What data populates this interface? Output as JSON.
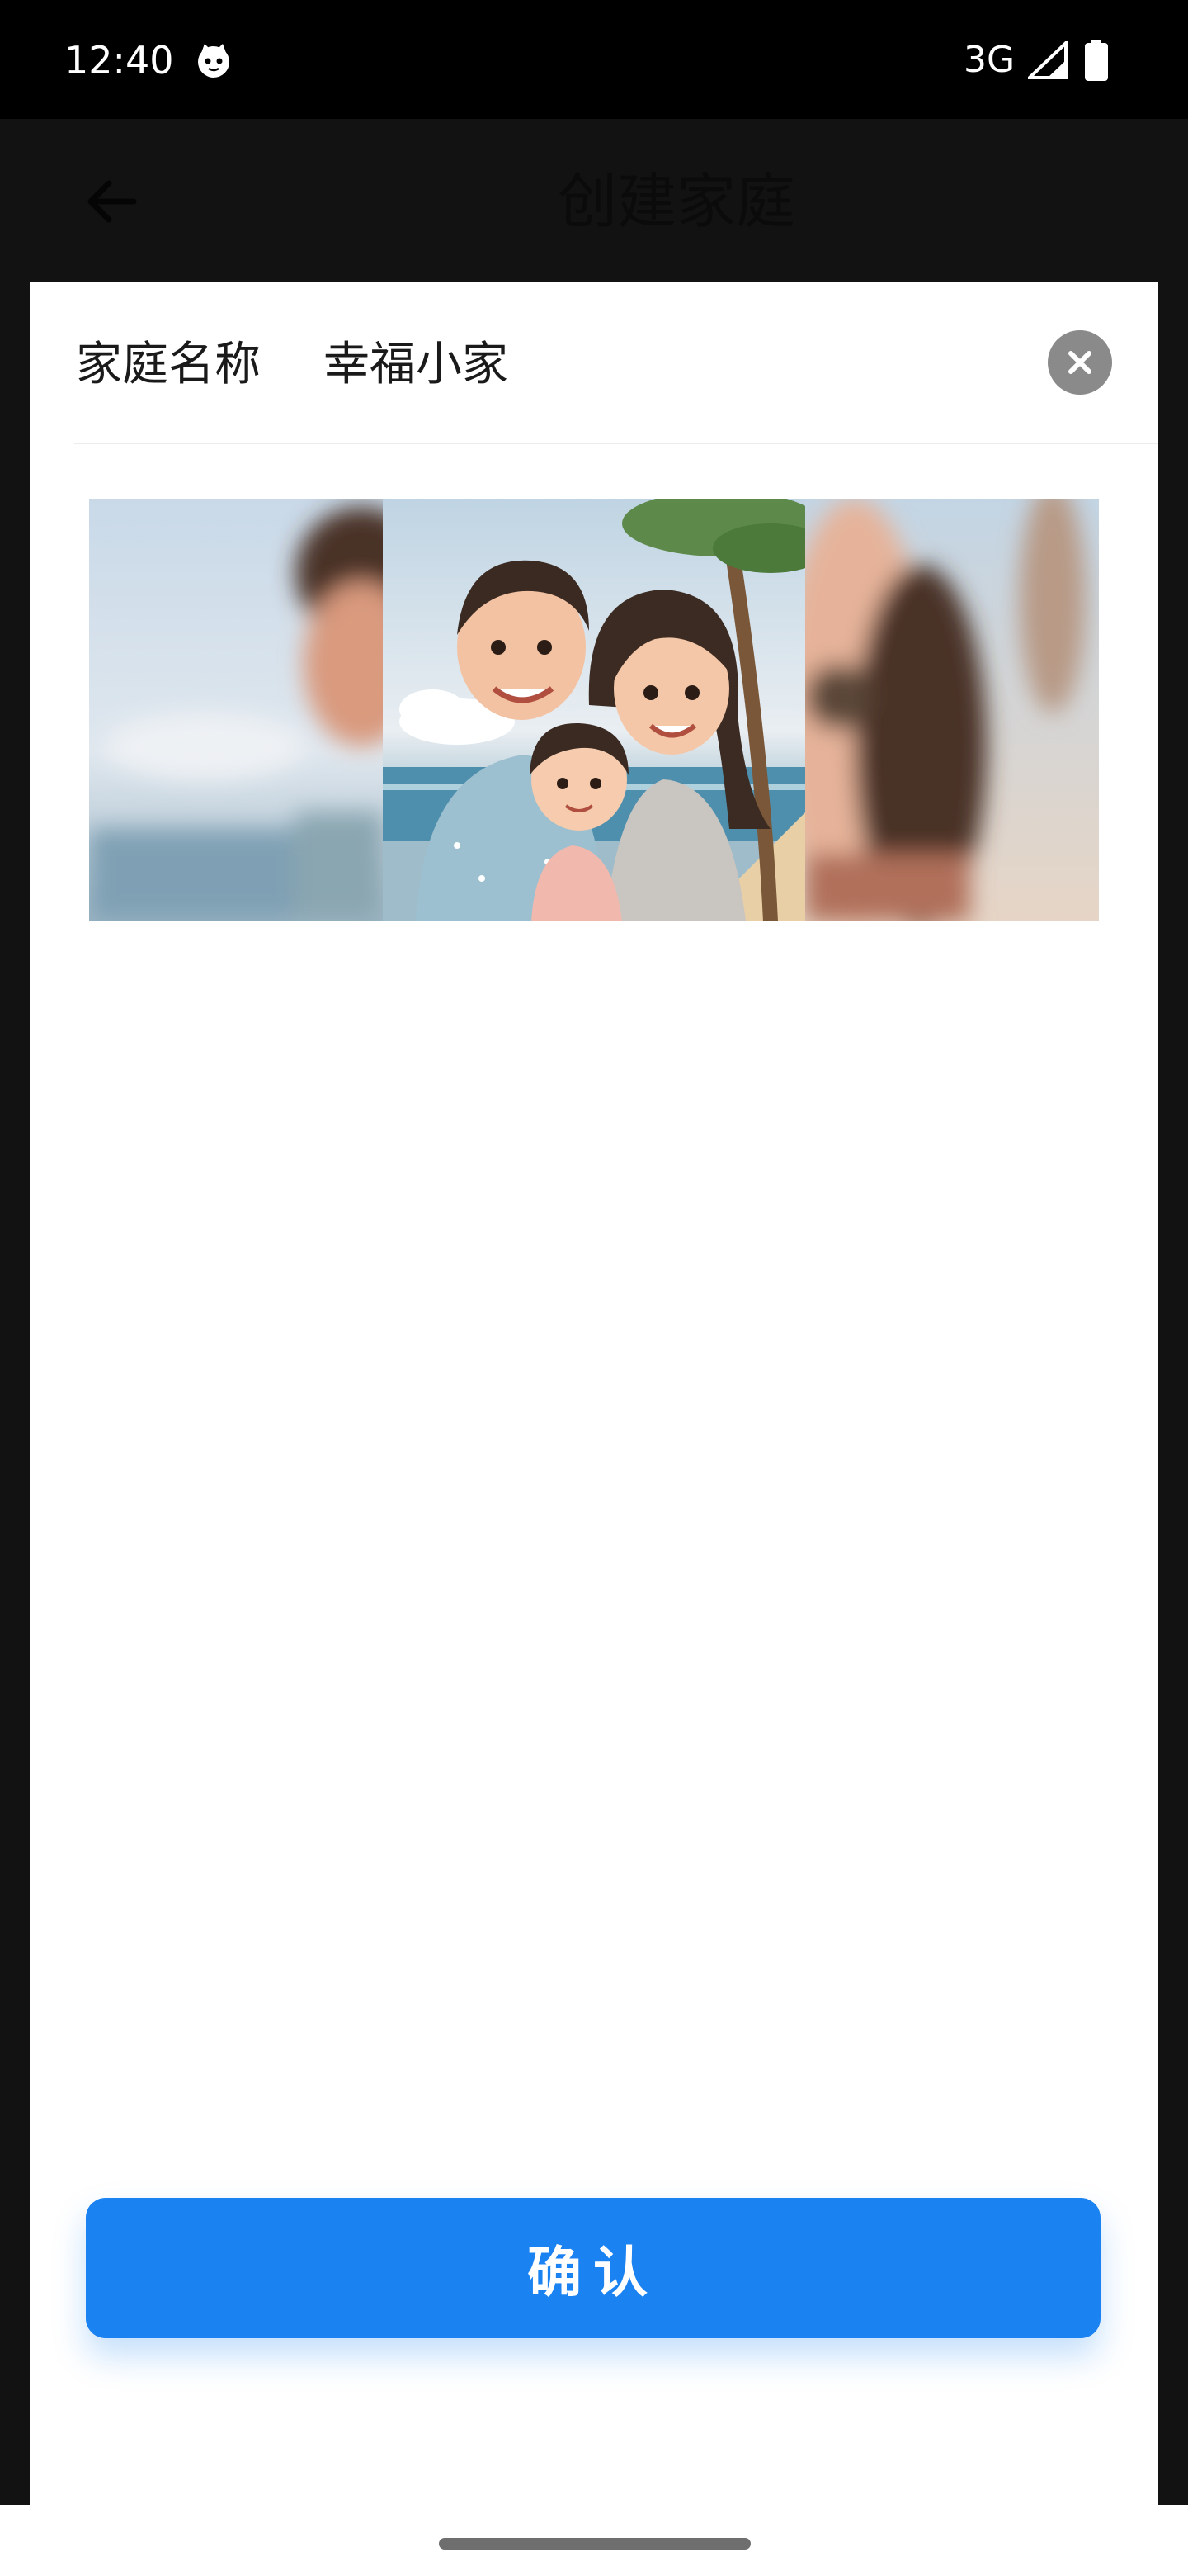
{
  "status_bar": {
    "time": "12:40",
    "network": "3G",
    "icons": [
      "cat-face-icon",
      "signal-icon",
      "battery-icon"
    ]
  },
  "app_bar": {
    "title": "创建家庭",
    "back_icon": "back-arrow-icon"
  },
  "sheet": {
    "field_label": "家庭名称",
    "field_value": "幸福小家",
    "close_icon": "close-icon",
    "carousel": {
      "items": [
        "family-cartoon-image-left",
        "family-cartoon-image-center",
        "family-cartoon-image-right"
      ]
    },
    "confirm_label": "确认"
  },
  "colors": {
    "accent": "#1b82f1",
    "background": "#121212",
    "sheet": "#ffffff"
  }
}
